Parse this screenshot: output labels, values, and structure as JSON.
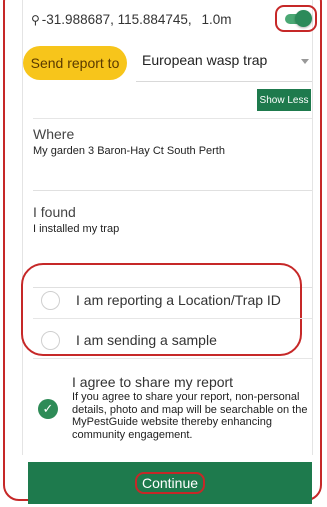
{
  "location": {
    "coordinates": "-31.988687, 115.884745,",
    "accuracy": "1.0m",
    "pin_icon": "location-pin-icon",
    "gps_enabled": true
  },
  "report": {
    "send_to_label": "Send report to",
    "selected_trap": "European wasp trap",
    "show_less_label": "Show Less"
  },
  "where": {
    "label": "Where",
    "value": "My garden 3 Baron-Hay Ct South Perth"
  },
  "found": {
    "label": "I found",
    "value": "I installed my trap"
  },
  "options": [
    {
      "label": "I am reporting a Location/Trap ID",
      "selected": false
    },
    {
      "label": "I am sending a sample",
      "selected": false
    }
  ],
  "agree": {
    "title": "I agree to share my report",
    "body": "If you agree to share your report, non-personal details, photo and map will be searchable on the MyPestGuide website thereby enhancing community engagement.",
    "checked": true
  },
  "continue_label": "Continue",
  "colors": {
    "accent_green": "#1e7a4d",
    "pill_yellow": "#f7c51b",
    "highlight_red": "#c62828"
  }
}
